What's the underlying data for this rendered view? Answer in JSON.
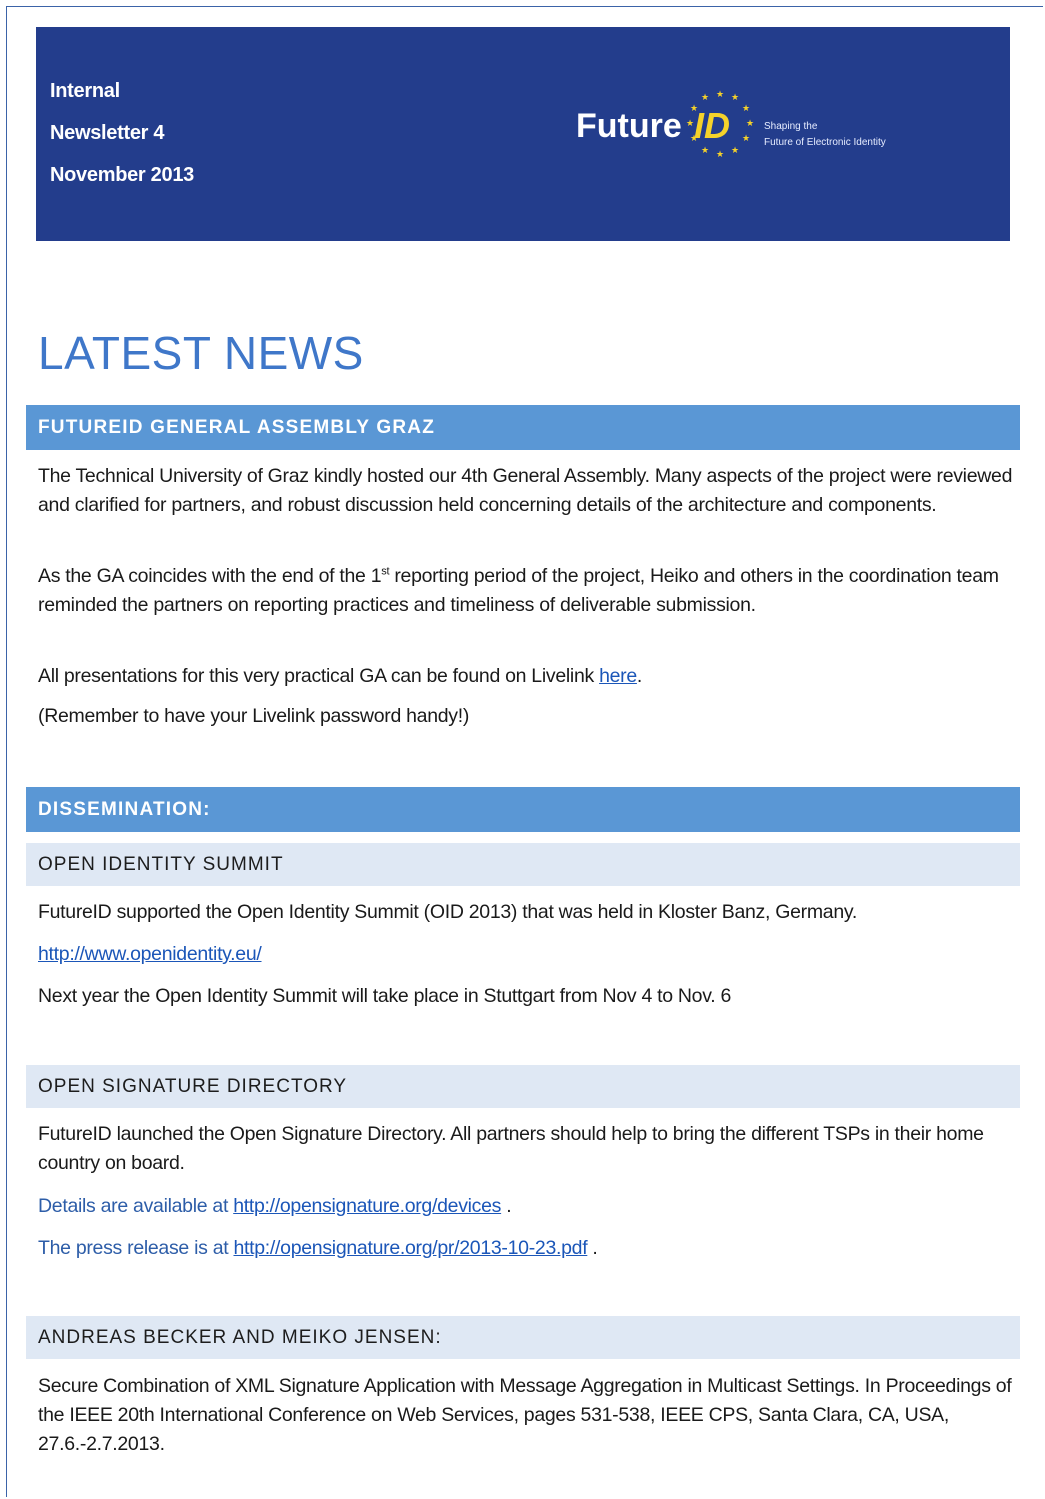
{
  "banner": {
    "line1": "Internal",
    "line2": "Newsletter 4",
    "line3": "November 2013",
    "logo_word": "Future",
    "logo_id": "ID",
    "tagline1": "Shaping the",
    "tagline2": "Future of Electronic Identity",
    "bg_color": "#233d8c"
  },
  "latest_news": {
    "title": "LATEST NEWS",
    "section1": {
      "heading": "FUTUREID GENERAL ASSEMBLY GRAZ",
      "p1": "The Technical University of Graz kindly hosted our 4th General Assembly. Many aspects of the project were reviewed and clarified for partners, and robust discussion held concerning details of the architecture and components.",
      "p2_before": "As the GA coincides with the end of the 1",
      "p2_sup": "st",
      "p2_after": " reporting period of the project, Heiko and others in the coordination team reminded the partners on reporting practices and timeliness of deliverable submission.",
      "p3_text": "All presentations for this very practical GA can be found on Livelink ",
      "p3_link": "here",
      "p3_end": ".",
      "p4": "(Remember to have your Livelink password handy!)"
    }
  },
  "dissemination": {
    "heading": "DISSEMINATION:",
    "open_identity": {
      "heading": "OPEN IDENTITY SUMMIT",
      "p1": "FutureID supported the Open Identity Summit (OID 2013) that was held in Kloster Banz, Germany.",
      "link": "http://www.openidentity.eu/",
      "p2": "Next year the Open Identity Summit will take place in Stuttgart from Nov 4 to Nov. 6"
    },
    "open_signature": {
      "heading": "OPEN SIGNATURE DIRECTORY",
      "p1": "FutureID launched the Open Signature Directory. All partners should help to bring the different TSPs in their home country on board.",
      "details_label": "Details are available at ",
      "details_link": "http://opensignature.org/devices",
      "details_end": " .",
      "press_label": "The press release is at ",
      "press_link": "http://opensignature.org/pr/2013-10-23.pdf",
      "press_end": " ."
    },
    "becker_jensen": {
      "heading": "ANDREAS BECKER AND MEIKO JENSEN:",
      "p1": "Secure Combination of XML Signature Application with Message Aggregation in Multicast Settings. In Proceedings of the IEEE 20th International Conference on Web Services, pages 531-538, IEEE CPS, Santa Clara, CA, USA, 27.6.-2.7.2013."
    }
  }
}
